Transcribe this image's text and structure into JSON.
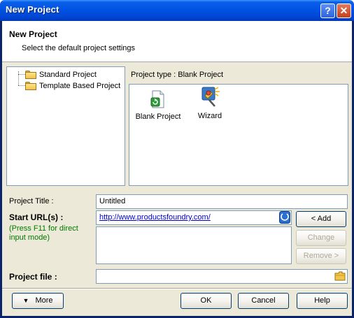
{
  "window": {
    "title": "New Project"
  },
  "header": {
    "title": "New Project",
    "subtitle": "Select the default project settings"
  },
  "tree": {
    "items": [
      {
        "label": "Standard Project"
      },
      {
        "label": "Template Based Project"
      }
    ]
  },
  "project_type": {
    "label": "Project type : Blank Project",
    "items": [
      {
        "label": "Blank Project",
        "icon": "blank-project-icon"
      },
      {
        "label": "Wizard",
        "icon": "wizard-icon"
      }
    ]
  },
  "form": {
    "project_title_label": "Project Title :",
    "project_title_value": "Untitled",
    "start_url_label": "Start URL(s) :",
    "start_url_hint": "(Press F11 for direct input mode)",
    "start_url_value": "http://www.productsfoundry.com/",
    "project_file_label": "Project file :",
    "project_file_value": ""
  },
  "buttons": {
    "add": "< Add",
    "change": "Change",
    "remove": "Remove >",
    "more": "More",
    "ok": "OK",
    "cancel": "Cancel",
    "help": "Help"
  },
  "colors": {
    "title_bar": "#0054e3",
    "close": "#c2401f",
    "hint": "#007a00",
    "link": "#0000cc"
  }
}
